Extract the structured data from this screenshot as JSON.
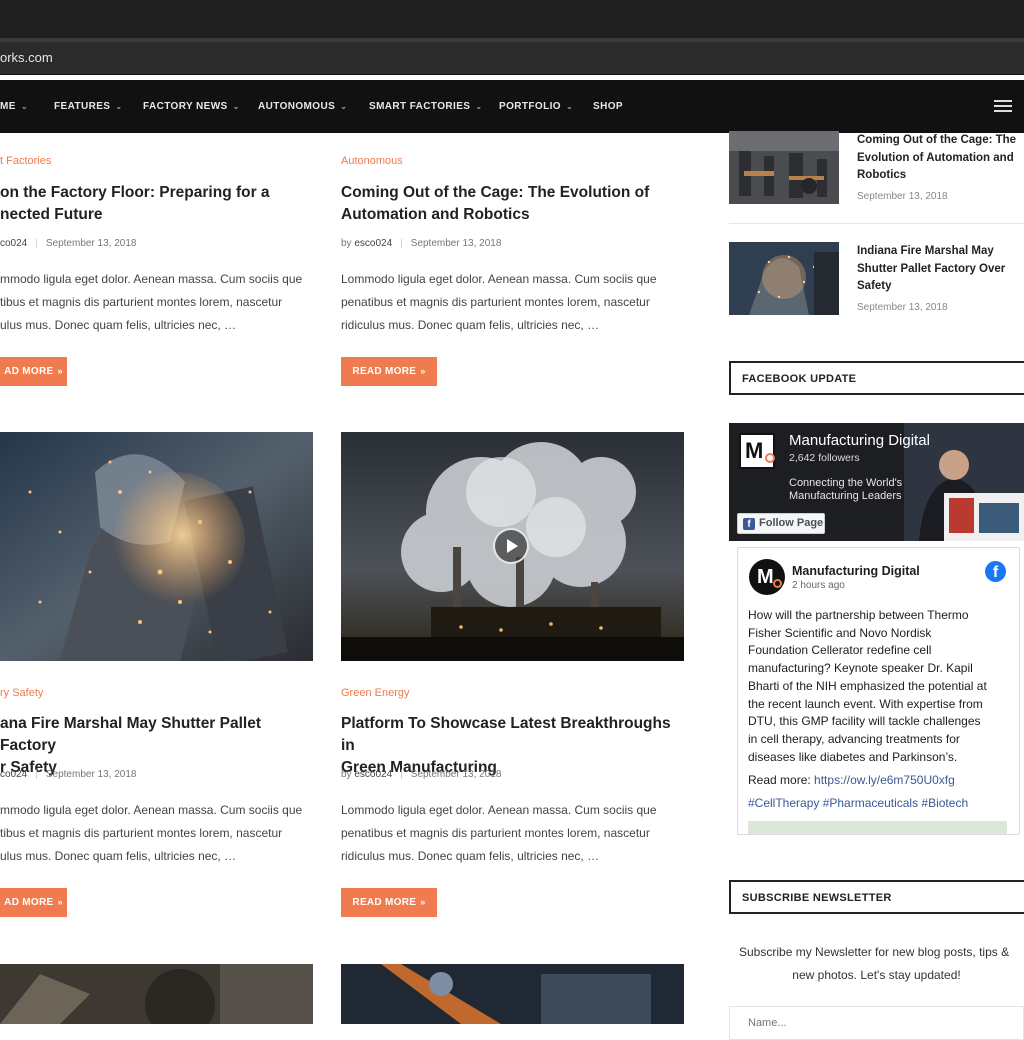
{
  "browser": {
    "url": "orks.com"
  },
  "nav": {
    "items": [
      {
        "label": "ME",
        "has_dropdown": true
      },
      {
        "label": "FEATURES",
        "has_dropdown": true
      },
      {
        "label": "FACTORY NEWS",
        "has_dropdown": true
      },
      {
        "label": "AUTONOMOUS",
        "has_dropdown": true
      },
      {
        "label": "SMART FACTORIES",
        "has_dropdown": true
      },
      {
        "label": "PORTFOLIO",
        "has_dropdown": true
      },
      {
        "label": "SHOP",
        "has_dropdown": false
      }
    ],
    "chevron": "⌄",
    "menu_icon": "hamburger-icon"
  },
  "posts": [
    {
      "category": "t Factories",
      "title_line1": "on the Factory Floor: Preparing for a",
      "title_line2": "nected Future",
      "author_prefix": "",
      "author": "co024",
      "date": "September 13, 2018",
      "excerpt_line1": "mmodo ligula eget dolor. Aenean massa. Cum sociis que",
      "excerpt_line2": "tibus et magnis dis parturient montes lorem, nascetur",
      "excerpt_line3": "ulus mus. Donec quam felis, ultricies nec, …",
      "button": "AD MORE"
    },
    {
      "category": "Autonomous",
      "title_line1": "Coming Out of the Cage: The Evolution of",
      "title_line2": "Automation and Robotics",
      "author_prefix": "by",
      "author": "esco024",
      "date": "September 13, 2018",
      "excerpt_line1": "Lommodo ligula eget dolor. Aenean massa. Cum sociis que",
      "excerpt_line2": "penatibus et magnis dis parturient montes lorem, nascetur",
      "excerpt_line3": "ridiculus mus. Donec quam felis, ultricies nec, …",
      "button": "READ MORE"
    },
    {
      "category": "ry Safety",
      "title_line1": "ana Fire Marshal May Shutter Pallet Factory",
      "title_line2": "r Safety",
      "author_prefix": "",
      "author": "co024",
      "date": "September 13, 2018",
      "excerpt_line1": "mmodo ligula eget dolor. Aenean massa. Cum sociis que",
      "excerpt_line2": "tibus et magnis dis parturient montes lorem, nascetur",
      "excerpt_line3": "ulus mus. Donec quam felis, ultricies nec, …",
      "button": "AD MORE"
    },
    {
      "category": "Green Energy",
      "title_line1": "Platform To Showcase Latest Breakthroughs in",
      "title_line2": "Green Manufacturing",
      "author_prefix": "by",
      "author": "esco024",
      "date": "September 13, 2018",
      "excerpt_line1": "Lommodo ligula eget dolor. Aenean massa. Cum sociis que",
      "excerpt_line2": "penatibus et magnis dis parturient montes lorem, nascetur",
      "excerpt_line3": "ridiculus mus. Donec quam felis, ultricies nec, …",
      "button": "READ MORE"
    }
  ],
  "button_arrow": "»",
  "sidebar": {
    "recent": [
      {
        "title_line1": "Coming Out of the Cage: The",
        "title_line2": "Evolution of Automation and",
        "title_line3": "Robotics",
        "date": "September 13, 2018"
      },
      {
        "title_line1": "Indiana Fire Marshal May",
        "title_line2": "Shutter Pallet Factory Over",
        "title_line3": "Safety",
        "date": "September 13, 2018"
      }
    ],
    "facebook_heading": "FACEBOOK UPDATE",
    "facebook": {
      "page_name": "Manufacturing Digital",
      "followers": "2,642 followers",
      "tagline_line1": "Connecting the World's",
      "tagline_line2": "Manufacturing Leaders",
      "follow_label": "Follow Page",
      "logo_letter": "M",
      "post_author": "Manufacturing Digital",
      "post_time": "2 hours ago",
      "post_lines": [
        "How will the partnership between Thermo",
        "Fisher Scientific and Novo Nordisk",
        "Foundation Cellerator redefine cell",
        "manufacturing? Keynote speaker Dr. Kapil",
        "Bharti of the NIH emphasized the potential at",
        "the recent launch event. With expertise from",
        "DTU, this GMP facility will tackle challenges",
        "in cell therapy, advancing treatments for",
        "diseases like diabetes and Parkinson’s."
      ],
      "read_more_label": "Read more:",
      "read_more_link": "https://ow.ly/e6m750U0xfg",
      "hashtags": "#CellTherapy #Pharmaceuticals #Biotech"
    },
    "newsletter_heading": "SUBSCRIBE NEWSLETTER",
    "newsletter_line1": "Subscribe my Newsletter for new blog posts, tips &",
    "newsletter_line2": "new photos. Let's stay updated!",
    "name_placeholder": "Name..."
  },
  "colors": {
    "accent": "#ef7b4f",
    "nav_bg": "#111111",
    "facebook_blue": "#1877f2"
  }
}
